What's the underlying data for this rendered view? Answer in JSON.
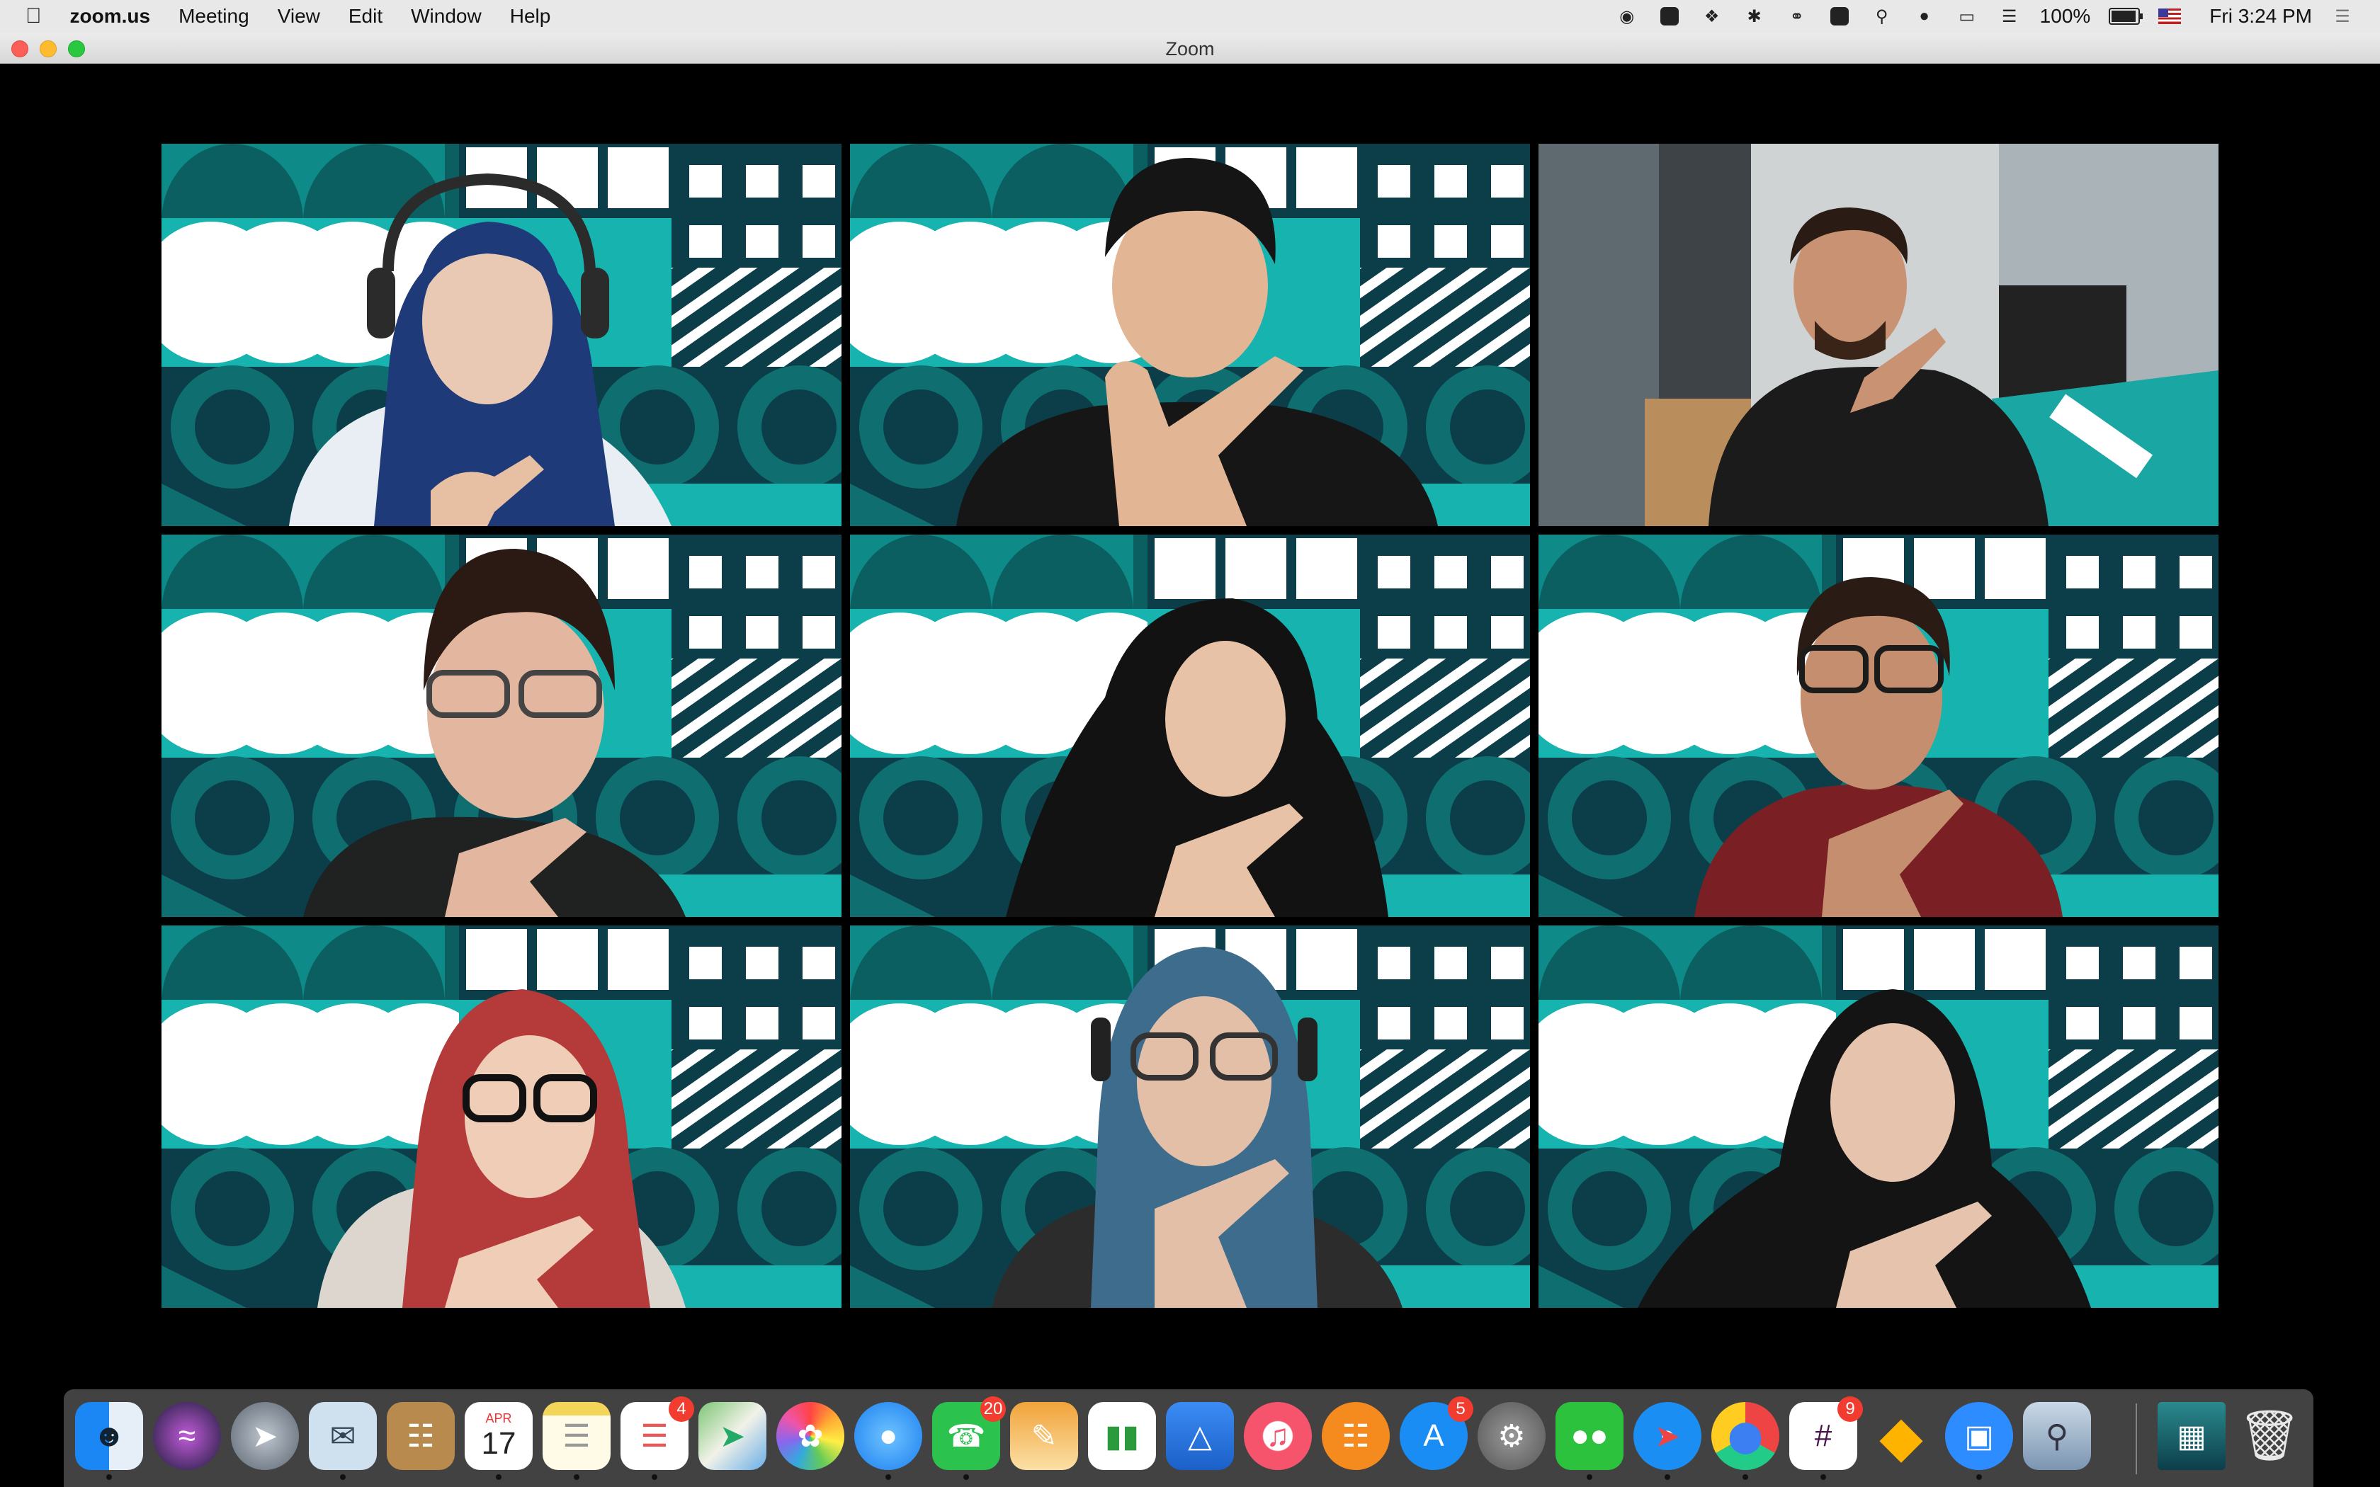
{
  "menubar": {
    "app_name": "zoom.us",
    "items": [
      "Meeting",
      "View",
      "Edit",
      "Window",
      "Help"
    ],
    "battery": "100%",
    "clock": "Fri 3:24 PM"
  },
  "window": {
    "title": "Zoom"
  },
  "gallery": {
    "active_speaker_index": 1,
    "accent_color": "#d8e56b",
    "background_colors": {
      "teal": "#16b5b0",
      "dark": "#0c3e4a",
      "mid": "#0f6f70"
    }
  },
  "dock": {
    "items": [
      {
        "name": "Finder",
        "icon": "finder-icon"
      },
      {
        "name": "Siri",
        "icon": "siri-icon"
      },
      {
        "name": "Launchpad",
        "icon": "launchpad-icon"
      },
      {
        "name": "Mail",
        "icon": "mail-icon"
      },
      {
        "name": "Contacts",
        "icon": "contacts-icon"
      },
      {
        "name": "Calendar",
        "icon": "calendar-icon",
        "month": "APR",
        "day": "17"
      },
      {
        "name": "Notes",
        "icon": "notes-icon"
      },
      {
        "name": "Reminders",
        "icon": "reminders-icon",
        "badge": "4"
      },
      {
        "name": "Maps",
        "icon": "maps-icon"
      },
      {
        "name": "Photos",
        "icon": "photos-icon"
      },
      {
        "name": "Messages",
        "icon": "messages-icon"
      },
      {
        "name": "FaceTime",
        "icon": "facetime-icon",
        "badge": "20"
      },
      {
        "name": "Pages",
        "icon": "pages-icon"
      },
      {
        "name": "Numbers",
        "icon": "numbers-icon"
      },
      {
        "name": "Keynote",
        "icon": "keynote-icon"
      },
      {
        "name": "Music",
        "icon": "music-icon"
      },
      {
        "name": "Books",
        "icon": "books-icon"
      },
      {
        "name": "App Store",
        "icon": "app-store-icon",
        "badge": "5"
      },
      {
        "name": "System Preferences",
        "icon": "system-preferences-icon"
      },
      {
        "name": "WeChat",
        "icon": "wechat-icon"
      },
      {
        "name": "Safari",
        "icon": "safari-icon"
      },
      {
        "name": "Chrome",
        "icon": "chrome-icon"
      },
      {
        "name": "Slack",
        "icon": "slack-icon",
        "badge": "9"
      },
      {
        "name": "Sketch",
        "icon": "sketch-icon"
      },
      {
        "name": "Zoom",
        "icon": "zoom-icon"
      },
      {
        "name": "Preview",
        "icon": "preview-icon"
      },
      {
        "name": "Downloads",
        "icon": "downloads-stack-icon"
      },
      {
        "name": "Trash",
        "icon": "trash-icon"
      }
    ]
  }
}
